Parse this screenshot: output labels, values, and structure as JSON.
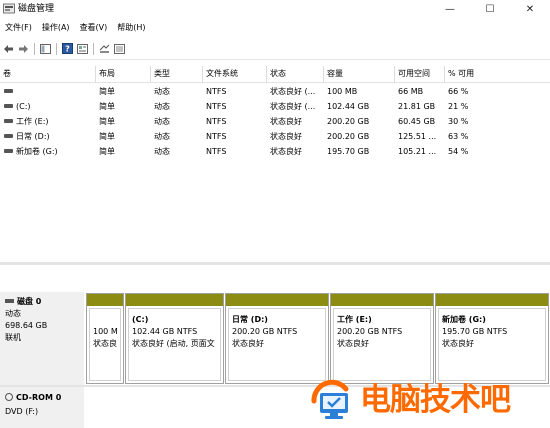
{
  "window": {
    "title": "磁盘管理",
    "min_glyph": "—",
    "max_glyph": "☐",
    "close_glyph": "✕"
  },
  "menu": [
    {
      "label": "文件(F)"
    },
    {
      "label": "操作(A)"
    },
    {
      "label": "查看(V)"
    },
    {
      "label": "帮助(H)"
    }
  ],
  "toolbar": [
    "back-icon",
    "forward-icon",
    "console-tree-icon",
    "help-icon",
    "properties-icon",
    "rescan-icon",
    "list-view-icon"
  ],
  "volume_table": {
    "columns": [
      "卷",
      "布局",
      "类型",
      "文件系统",
      "状态",
      "容量",
      "可用空间",
      "% 可用"
    ],
    "rows": [
      [
        "",
        "简单",
        "动态",
        "NTFS",
        "状态良好 (...",
        "100 MB",
        "66 MB",
        "66 %"
      ],
      [
        "(C:)",
        "简单",
        "动态",
        "NTFS",
        "状态良好 (...",
        "102.44 GB",
        "21.81 GB",
        "21 %"
      ],
      [
        "工作 (E:)",
        "简单",
        "动态",
        "NTFS",
        "状态良好",
        "200.20 GB",
        "60.45 GB",
        "30 %"
      ],
      [
        "日常 (D:)",
        "简单",
        "动态",
        "NTFS",
        "状态良好",
        "200.20 GB",
        "125.51 ...",
        "63 %"
      ],
      [
        "新加卷 (G:)",
        "简单",
        "动态",
        "NTFS",
        "状态良好",
        "195.70 GB",
        "105.21 ...",
        "54 %"
      ]
    ]
  },
  "disk0": {
    "name": "磁盘 0",
    "type": "动态",
    "size": "698.64 GB",
    "status": "联机",
    "partitions": [
      {
        "title": "",
        "size": "100 M",
        "status": "状态良"
      },
      {
        "title": "(C:)",
        "size": "102.44 GB NTFS",
        "status": "状态良好 (启动, 页面文"
      },
      {
        "title": "日常  (D:)",
        "size": "200.20 GB NTFS",
        "status": "状态良好"
      },
      {
        "title": "工作  (E:)",
        "size": "200.20 GB NTFS",
        "status": "状态良好"
      },
      {
        "title": "新加卷  (G:)",
        "size": "195.70 GB NTFS",
        "status": "状态良好"
      }
    ]
  },
  "cdrom": {
    "name": "CD-ROM 0",
    "drive": "DVD (F:)"
  },
  "watermark": {
    "text": "电脑技术吧",
    "color": "#ff6a00"
  },
  "colors": {
    "partition_band": "#8c8c12"
  }
}
